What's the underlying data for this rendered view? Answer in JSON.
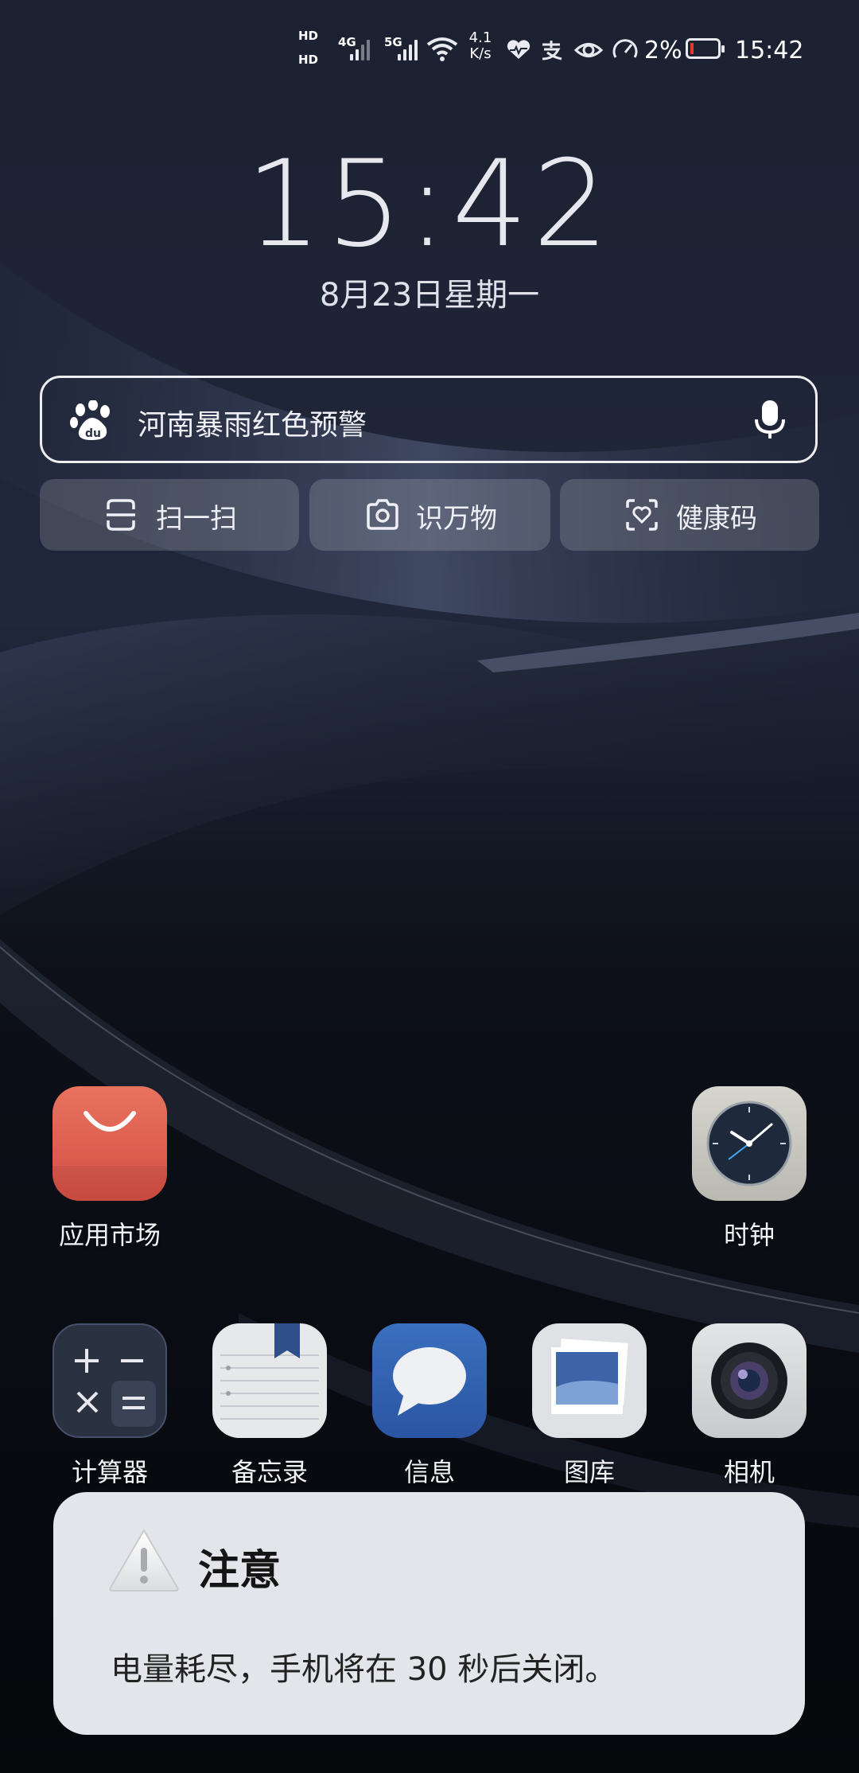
{
  "status_bar": {
    "sim1_label": "HD",
    "sim1_net": "4G",
    "sim2_label": "HD",
    "sim2_net": "5G",
    "speed_value": "4.1",
    "speed_unit": "K/s",
    "battery_percent": "2%",
    "time": "15:42",
    "battery_level": 0.02
  },
  "clock": {
    "time": "15:42",
    "date": "8月23日星期一"
  },
  "search": {
    "placeholder": "河南暴雨红色预警",
    "buttons": [
      {
        "label": "扫一扫",
        "icon": "scan-icon"
      },
      {
        "label": "识万物",
        "icon": "camera-icon"
      },
      {
        "label": "健康码",
        "icon": "health-code-icon"
      }
    ]
  },
  "apps_row1": [
    {
      "label": "应用市场",
      "icon": "app-market-icon"
    },
    {
      "label": "时钟",
      "icon": "clock-icon"
    }
  ],
  "apps_row2": [
    {
      "label": "计算器",
      "icon": "calculator-icon"
    },
    {
      "label": "备忘录",
      "icon": "notepad-icon"
    },
    {
      "label": "信息",
      "icon": "messages-icon"
    },
    {
      "label": "图库",
      "icon": "gallery-icon"
    },
    {
      "label": "相机",
      "icon": "camera-app-icon"
    }
  ],
  "dialog": {
    "title": "注意",
    "message": "电量耗尽，手机将在 30 秒后关闭。"
  }
}
